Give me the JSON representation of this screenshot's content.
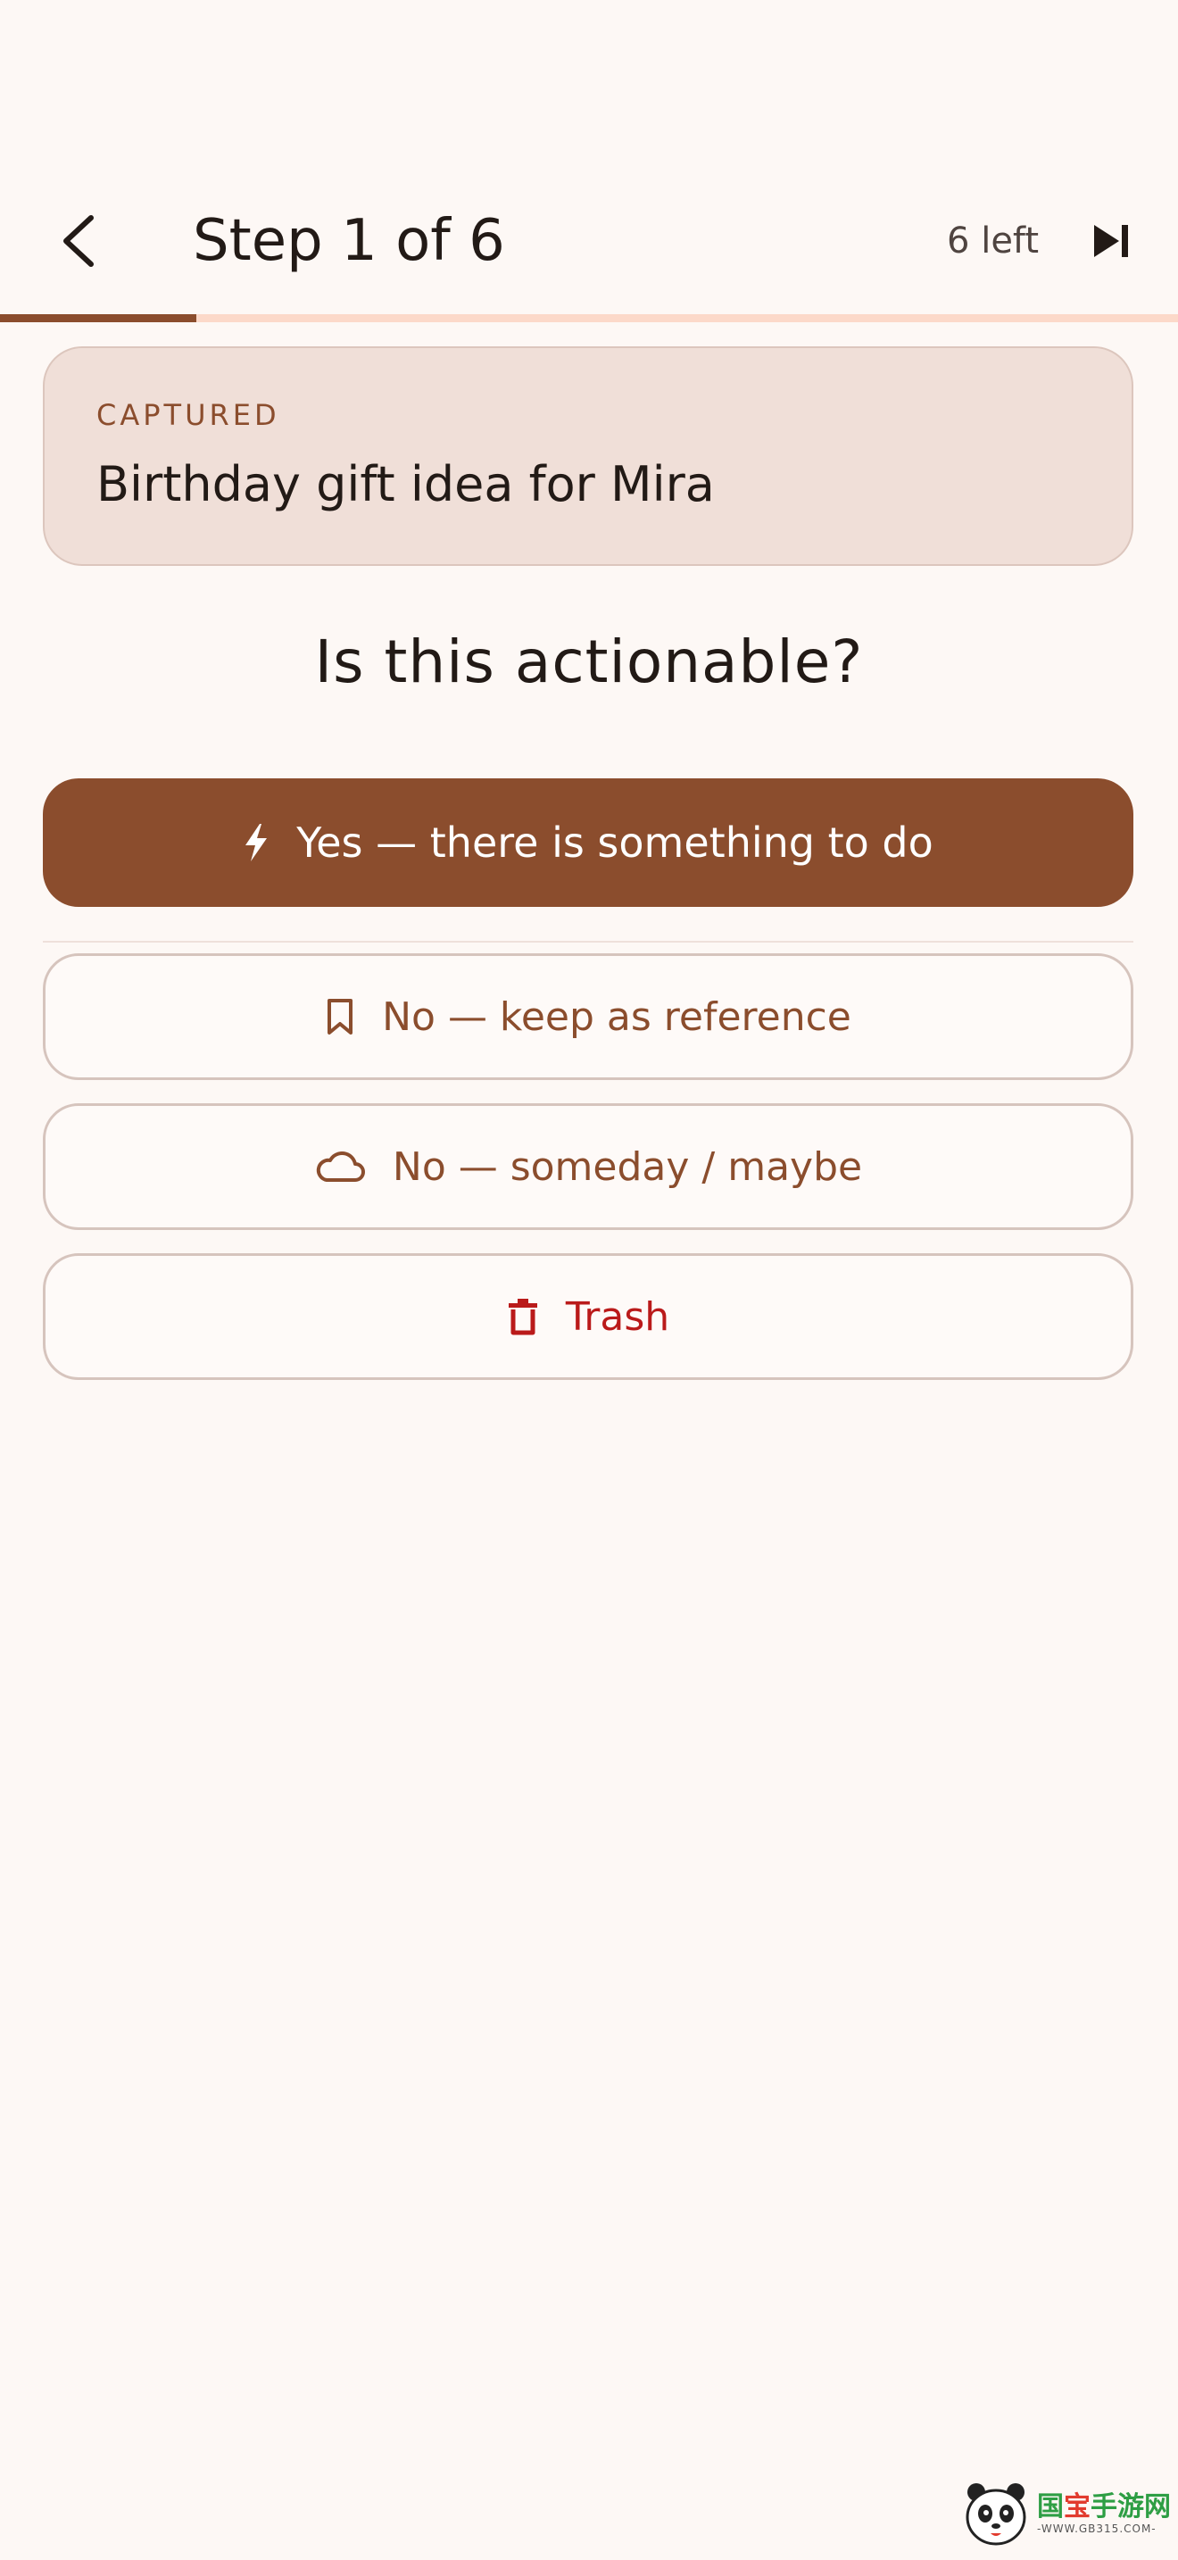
{
  "header": {
    "title": "Step 1 of 6",
    "remaining": "6 left"
  },
  "progress": {
    "current": 1,
    "total": 6
  },
  "captured": {
    "label": "CAPTURED",
    "text": "Birthday gift idea for Mira"
  },
  "question": "Is this actionable?",
  "actions": {
    "yes": {
      "label": "Yes — there is something to do",
      "icon": "bolt-icon"
    },
    "reference": {
      "label": "No — keep as reference",
      "icon": "bookmark-icon"
    },
    "someday": {
      "label": "No — someday / maybe",
      "icon": "cloud-icon"
    },
    "trash": {
      "label": "Trash",
      "icon": "trash-icon"
    }
  },
  "watermark": {
    "main_green": "国",
    "main_red": "宝",
    "main_rest": "手游网",
    "sub": "-WWW.GB315.COM-"
  },
  "colors": {
    "background": "#fdf8f5",
    "primary": "#8b4d2d",
    "progress_track": "#fcd9c9",
    "card": "#f0dfd8",
    "danger": "#ba1a1a"
  }
}
